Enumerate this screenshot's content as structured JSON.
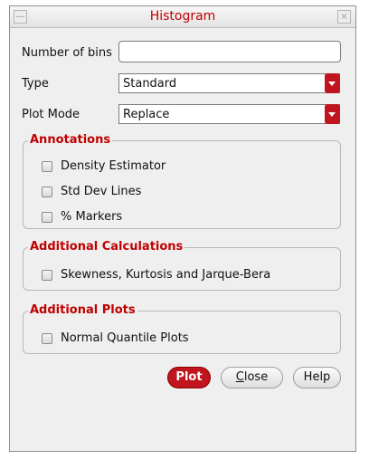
{
  "window": {
    "title": "Histogram",
    "minimize_glyph": "—",
    "close_glyph": "×"
  },
  "form": {
    "bins_label": "Number of bins",
    "bins_value": "",
    "type_label": "Type",
    "type_value": "Standard",
    "plot_mode_label": "Plot Mode",
    "plot_mode_value": "Replace"
  },
  "annotations": {
    "title": "Annotations",
    "items": [
      {
        "label": "Density Estimator",
        "checked": false
      },
      {
        "label": "Std Dev Lines",
        "checked": false
      },
      {
        "label": "% Markers",
        "checked": false
      }
    ]
  },
  "additional_calculations": {
    "title": "Additional Calculations",
    "items": [
      {
        "label": "Skewness, Kurtosis and Jarque-Bera",
        "checked": false
      }
    ]
  },
  "additional_plots": {
    "title": "Additional Plots",
    "items": [
      {
        "label": "Normal Quantile Plots",
        "checked": false
      }
    ]
  },
  "buttons": {
    "plot": "Plot",
    "close_mnemonic": "C",
    "close_rest": "lose",
    "help": "Help"
  },
  "colors": {
    "accent": "#c0141e",
    "group_title": "#c00000"
  }
}
